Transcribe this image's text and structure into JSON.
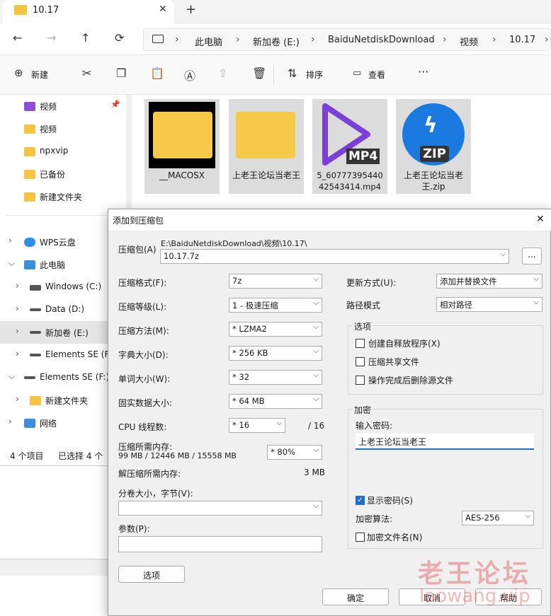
{
  "tab": {
    "title": "10.17",
    "close": "✕",
    "new": "+"
  },
  "nav": {
    "back": "←",
    "forward": "→",
    "up": "↑",
    "refresh": "⟳",
    "breadcrumb": [
      "此电脑",
      "新加卷 (E:)",
      "BaiduNetdiskDownload",
      "视频",
      "10.17"
    ],
    "sep": "›"
  },
  "toolbar": {
    "new": "新建",
    "sort": "排序",
    "view": "查看",
    "more": "···"
  },
  "sidebar": {
    "items": [
      "视频",
      "视频",
      "npxvip",
      "已备份",
      "新建文件夹",
      "WPS云盘",
      "此电脑",
      "Windows (C:)",
      "Data (D:)",
      "新加卷 (E:)",
      "Elements SE (F:)",
      "Elements SE (F:)",
      "新建文件夹",
      "网络"
    ]
  },
  "status": {
    "count": "4 个项目",
    "selected": "已选择 4 个"
  },
  "files": [
    "__MACOSX",
    "上老王论坛当老王",
    "5_60777395440 42543414.mp4",
    "上老王论坛当老王.zip"
  ],
  "file_badges": {
    "mp4": "MP4",
    "zip": "ZIP"
  },
  "dialog": {
    "title": "添加到压缩包",
    "close": "✕",
    "archive_label": "压缩包(A)",
    "archive_path": "E:\\BaiduNetdiskDownload\\视频\\10.17\\",
    "archive_name": "10.17.7z",
    "browse": "...",
    "format_label": "压缩格式(F):",
    "format": "7z",
    "level_label": "压缩等级(L):",
    "level": "1 - 极速压缩",
    "method_label": "压缩方法(M):",
    "method": "* LZMA2",
    "dict_label": "字典大小(D):",
    "dict": "* 256 KB",
    "word_label": "单词大小(W):",
    "word": "* 32",
    "solid_label": "固实数据大小:",
    "solid": "* 64 MB",
    "cpu_label": "CPU 线程数:",
    "cpu": "* 16",
    "cpu_total": "/ 16",
    "mem_label": "压缩所需内存:",
    "mem_value": "99 MB / 12446 MB / 15558 MB",
    "mem_pct": "* 80%",
    "decomp_label": "解压缩所需内存:",
    "decomp_value": "3 MB",
    "split_label": "分卷大小，字节(V):",
    "params_label": "参数(P):",
    "options_btn": "选项",
    "update_label": "更新方式(U):",
    "update": "添加并替换文件",
    "path_label": "路径模式",
    "path": "相对路径",
    "opts_title": "选项",
    "opt_sfx": "创建自释放程序(X)",
    "opt_shared": "压缩共享文件",
    "opt_delete": "操作完成后删除源文件",
    "enc_title": "加密",
    "pwd_label": "输入密码:",
    "pwd": "上老王论坛当老王",
    "show_pwd": "显示密码(S)",
    "enc_method_label": "加密算法:",
    "enc_method": "AES-256",
    "enc_names": "加密文件名(N)",
    "ok": "确定",
    "cancel": "取消",
    "help": "帮助",
    "check": "✓",
    "arrow": "⌵"
  },
  "watermark": {
    "line1": "老王论坛",
    "line2": "laowang.vip"
  }
}
